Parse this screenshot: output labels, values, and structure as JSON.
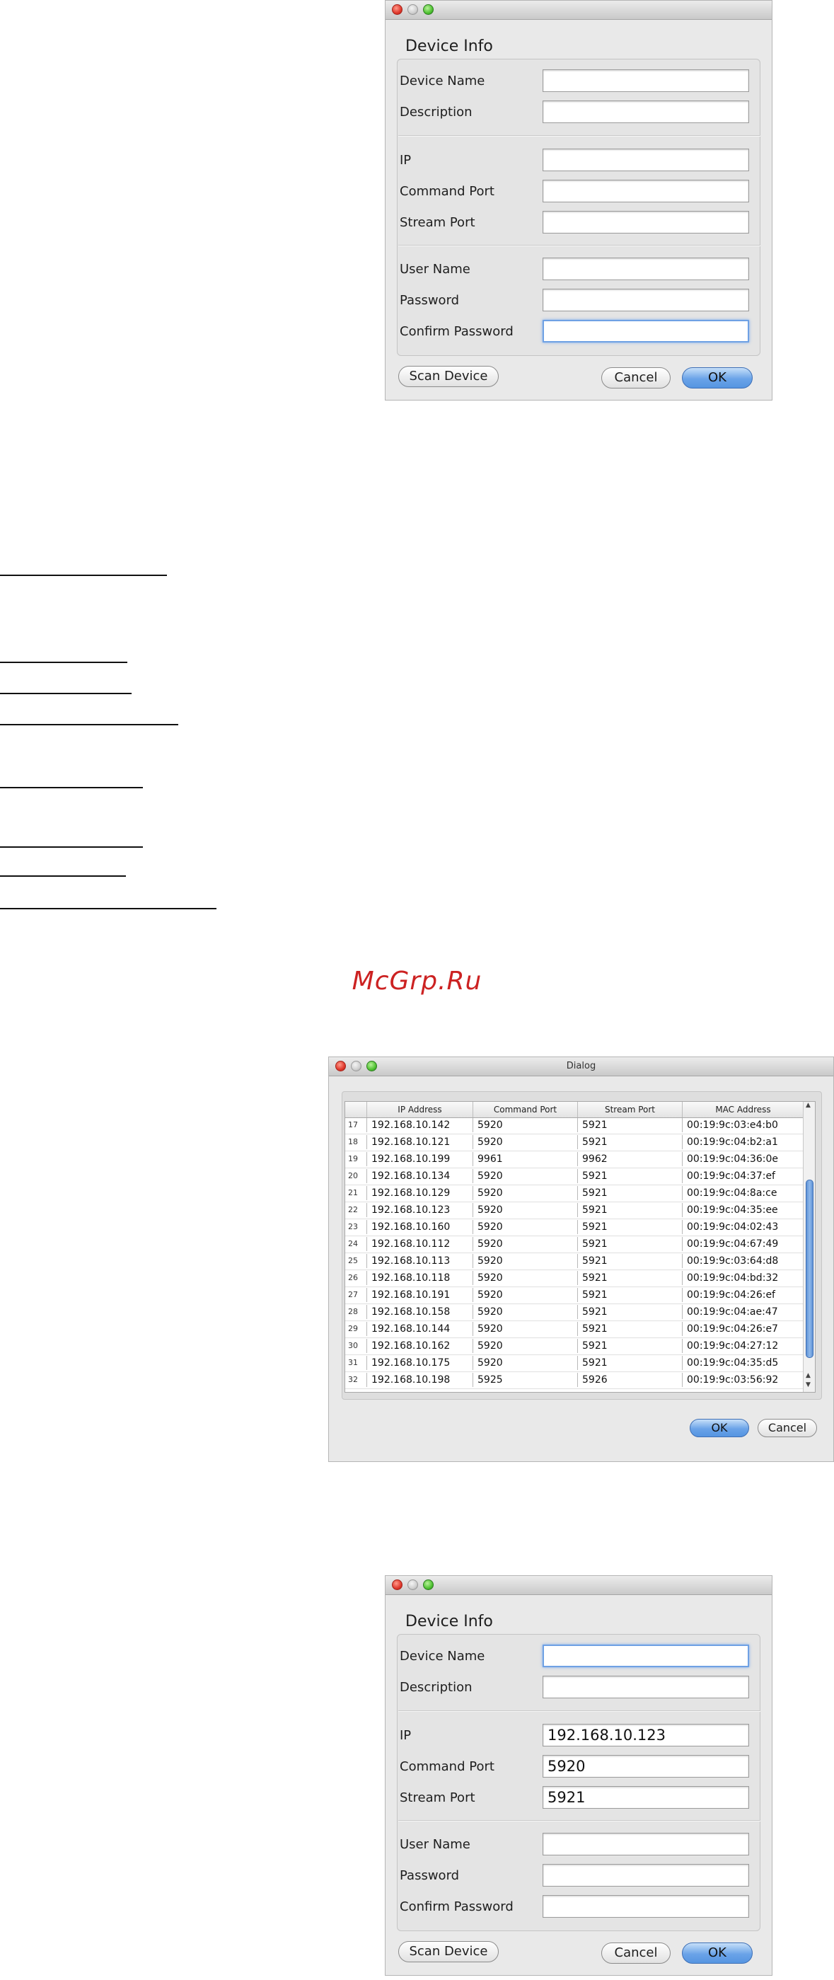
{
  "dialog1": {
    "heading": "Device Info",
    "fields": [
      {
        "label": "Device Name",
        "value": ""
      },
      {
        "label": "Description",
        "value": ""
      },
      {
        "label": "IP",
        "value": ""
      },
      {
        "label": "Command Port",
        "value": ""
      },
      {
        "label": "Stream Port",
        "value": ""
      },
      {
        "label": "User Name",
        "value": ""
      },
      {
        "label": "Password",
        "value": ""
      },
      {
        "label": "Confirm Password",
        "value": ""
      }
    ],
    "scan_label": "Scan Device",
    "cancel_label": "Cancel",
    "ok_label": "OK"
  },
  "watermark": "McGrp.Ru",
  "scan_dialog": {
    "title": "Dialog",
    "columns": [
      "IP Address",
      "Command Port",
      "Stream Port",
      "MAC Address"
    ],
    "rows": [
      {
        "n": "17",
        "ip": "192.168.10.142",
        "cmd": "5920",
        "stream": "5921",
        "mac": "00:19:9c:03:e4:b0"
      },
      {
        "n": "18",
        "ip": "192.168.10.121",
        "cmd": "5920",
        "stream": "5921",
        "mac": "00:19:9c:04:b2:a1"
      },
      {
        "n": "19",
        "ip": "192.168.10.199",
        "cmd": "9961",
        "stream": "9962",
        "mac": "00:19:9c:04:36:0e"
      },
      {
        "n": "20",
        "ip": "192.168.10.134",
        "cmd": "5920",
        "stream": "5921",
        "mac": "00:19:9c:04:37:ef"
      },
      {
        "n": "21",
        "ip": "192.168.10.129",
        "cmd": "5920",
        "stream": "5921",
        "mac": "00:19:9c:04:8a:ce"
      },
      {
        "n": "22",
        "ip": "192.168.10.123",
        "cmd": "5920",
        "stream": "5921",
        "mac": "00:19:9c:04:35:ee"
      },
      {
        "n": "23",
        "ip": "192.168.10.160",
        "cmd": "5920",
        "stream": "5921",
        "mac": "00:19:9c:04:02:43"
      },
      {
        "n": "24",
        "ip": "192.168.10.112",
        "cmd": "5920",
        "stream": "5921",
        "mac": "00:19:9c:04:67:49"
      },
      {
        "n": "25",
        "ip": "192.168.10.113",
        "cmd": "5920",
        "stream": "5921",
        "mac": "00:19:9c:03:64:d8"
      },
      {
        "n": "26",
        "ip": "192.168.10.118",
        "cmd": "5920",
        "stream": "5921",
        "mac": "00:19:9c:04:bd:32"
      },
      {
        "n": "27",
        "ip": "192.168.10.191",
        "cmd": "5920",
        "stream": "5921",
        "mac": "00:19:9c:04:26:ef"
      },
      {
        "n": "28",
        "ip": "192.168.10.158",
        "cmd": "5920",
        "stream": "5921",
        "mac": "00:19:9c:04:ae:47"
      },
      {
        "n": "29",
        "ip": "192.168.10.144",
        "cmd": "5920",
        "stream": "5921",
        "mac": "00:19:9c:04:26:e7"
      },
      {
        "n": "30",
        "ip": "192.168.10.162",
        "cmd": "5920",
        "stream": "5921",
        "mac": "00:19:9c:04:27:12"
      },
      {
        "n": "31",
        "ip": "192.168.10.175",
        "cmd": "5920",
        "stream": "5921",
        "mac": "00:19:9c:04:35:d5"
      },
      {
        "n": "32",
        "ip": "192.168.10.198",
        "cmd": "5925",
        "stream": "5926",
        "mac": "00:19:9c:03:56:92"
      }
    ],
    "ok_label": "OK",
    "cancel_label": "Cancel"
  },
  "dialog2": {
    "heading": "Device Info",
    "fields": [
      {
        "label": "Device Name",
        "value": ""
      },
      {
        "label": "Description",
        "value": ""
      },
      {
        "label": "IP",
        "value": "192.168.10.123"
      },
      {
        "label": "Command Port",
        "value": "5920"
      },
      {
        "label": "Stream Port",
        "value": "5921"
      },
      {
        "label": "User Name",
        "value": ""
      },
      {
        "label": "Password",
        "value": ""
      },
      {
        "label": "Confirm Password",
        "value": ""
      }
    ],
    "scan_label": "Scan Device",
    "cancel_label": "Cancel",
    "ok_label": "OK"
  }
}
